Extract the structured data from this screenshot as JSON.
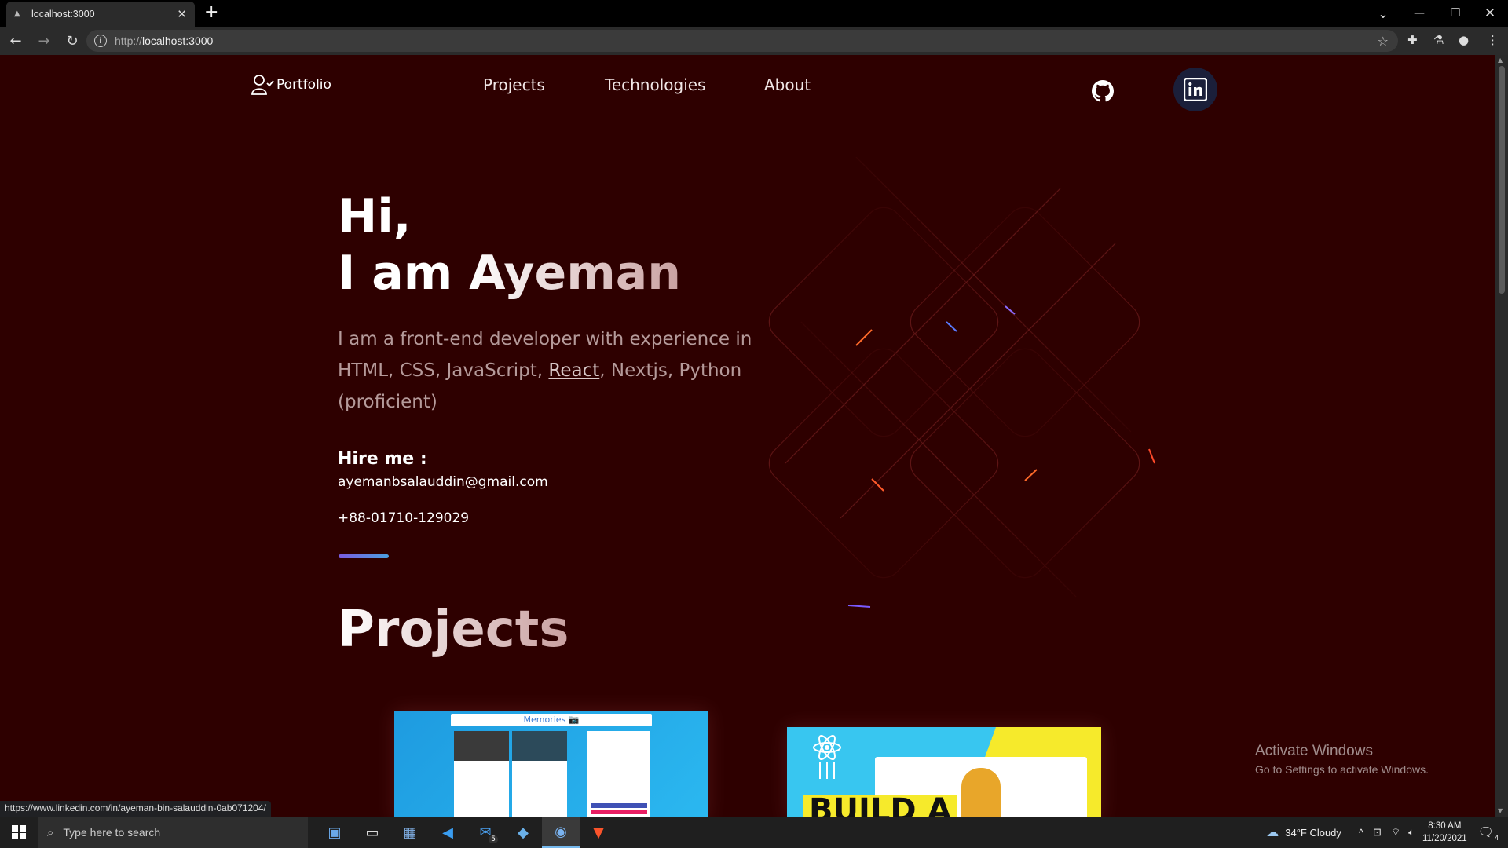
{
  "browser": {
    "tab_title": "localhost:3000",
    "url_prefix": "http://",
    "url_host": "localhost:3000",
    "status_url": "https://www.linkedin.com/in/ayeman-bin-salauddin-0ab071204/"
  },
  "site": {
    "logo_text": "Portfolio",
    "nav": [
      "Projects",
      "Technologies",
      "About"
    ],
    "hero": {
      "greeting": "Hi,",
      "iam": "I am ",
      "name": "Ayeman",
      "intro_before": "I am a front-end developer with experience in HTML, CSS, JavaScript, ",
      "intro_link": "React",
      "intro_after": ", Nextjs, Python (proficient)",
      "hire_label": "Hire me :",
      "email": "ayemanbsalauddin@gmail.com",
      "phone": "+88-01710-129029"
    },
    "projects_title": "Projects",
    "project_cards": [
      {
        "header": "Memories 📷"
      },
      {
        "headline": "BUILD A"
      }
    ]
  },
  "windows": {
    "activate_title": "Activate Windows",
    "activate_sub": "Go to Settings to activate Windows."
  },
  "taskbar": {
    "search_placeholder": "Type here to search",
    "mail_badge": "5",
    "weather": "34°F  Cloudy",
    "time": "8:30 AM",
    "date": "11/20/2021",
    "notif_count": "4"
  },
  "colors": {
    "page_bg": "#2e0000",
    "accent_gradient_start": "#7b5be0",
    "accent_gradient_end": "#4aa0e0",
    "linkedin_bg": "#1b1f3a"
  }
}
